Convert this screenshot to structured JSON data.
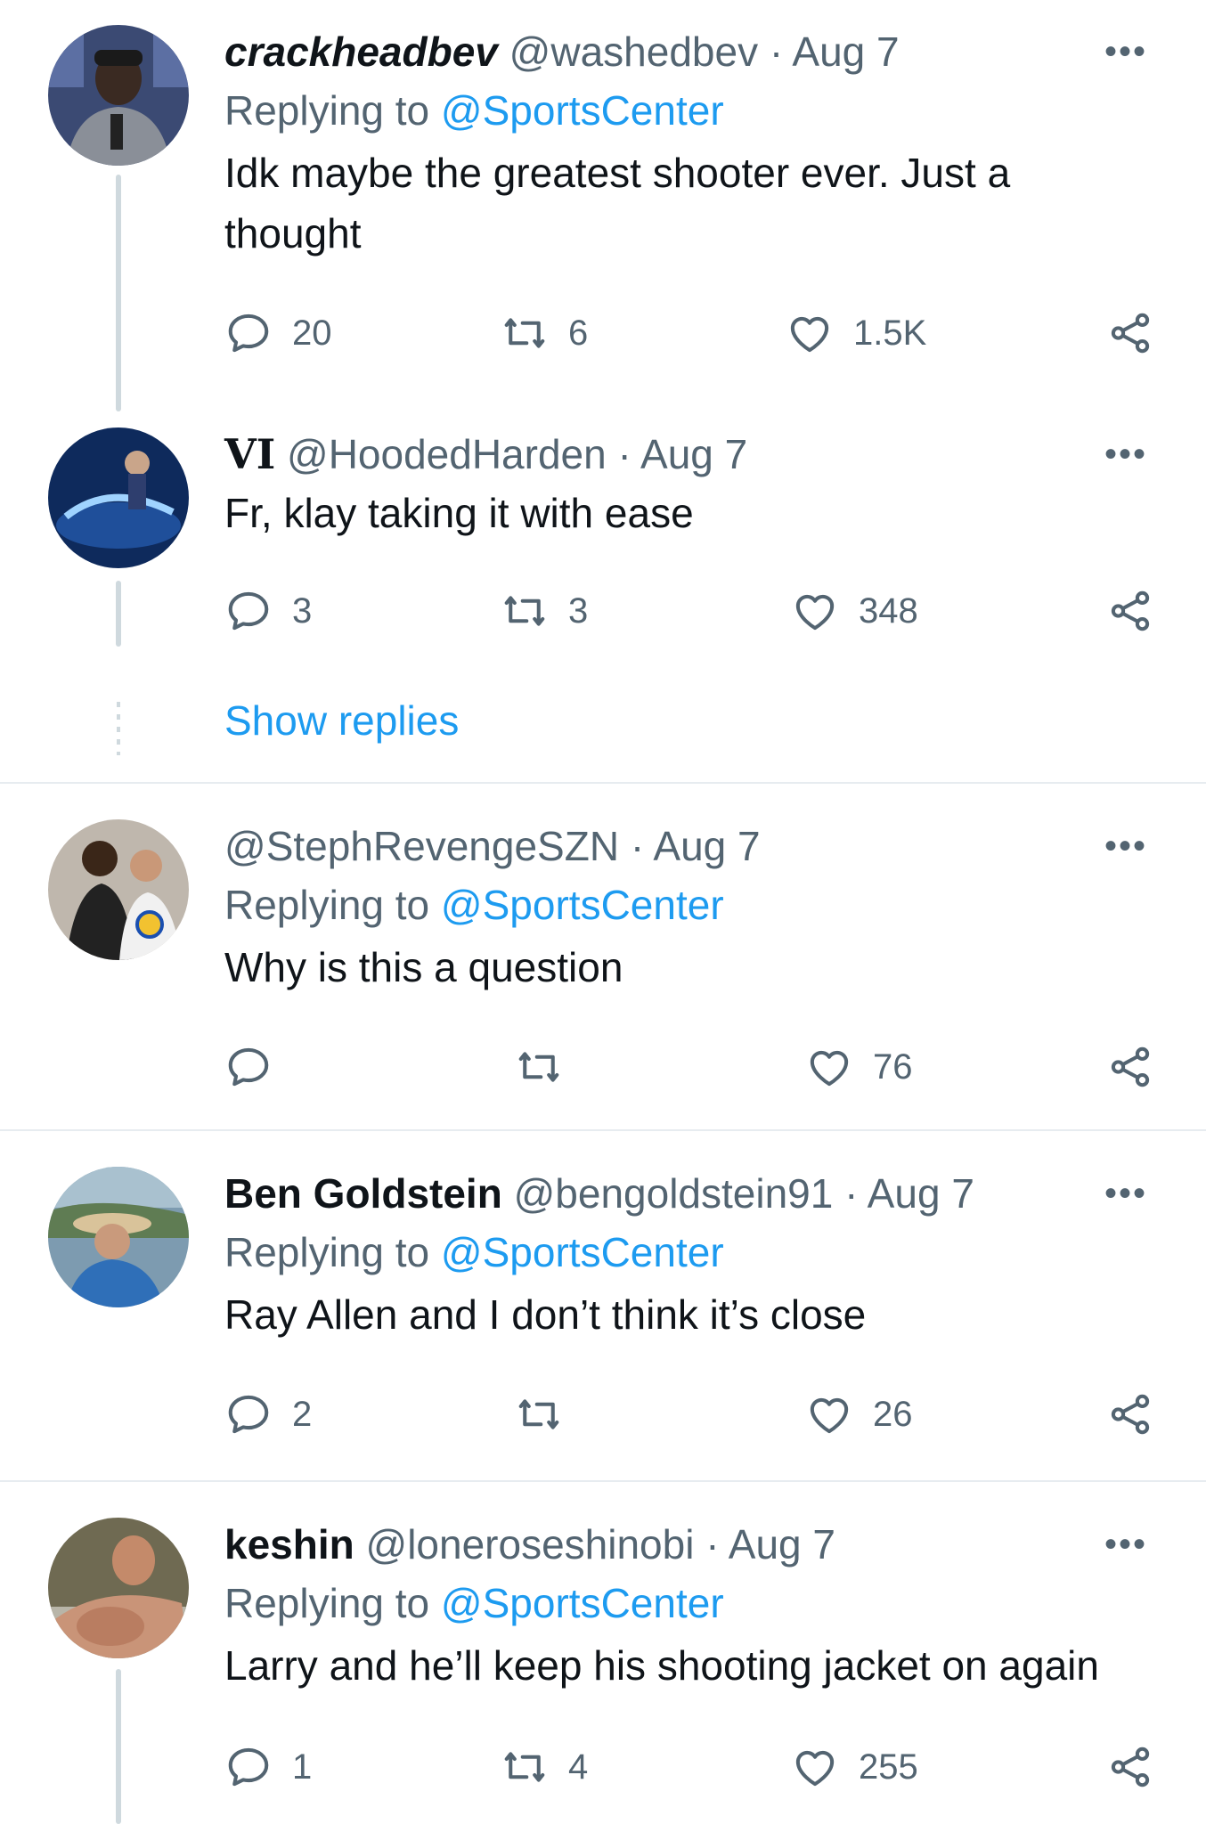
{
  "tweets": [
    {
      "display_name": "crackheadbev",
      "handle": "@washedbev",
      "date": "· Aug 7",
      "replying_prefix": "Replying to",
      "replying_to": "@SportsCenter",
      "text": "Idk maybe the greatest shooter ever. Just a thought",
      "replies": "20",
      "retweets": "6",
      "likes": "1.5K"
    },
    {
      "display_name": "VI",
      "handle": "@HoodedHarden",
      "date": "· Aug 7",
      "text": "Fr, klay taking it with ease",
      "replies": "3",
      "retweets": "3",
      "likes": "348",
      "show_replies": "Show replies"
    },
    {
      "display_name": "",
      "handle": "@StephRevengeSZN",
      "date": "· Aug 7",
      "replying_prefix": "Replying to",
      "replying_to": "@SportsCenter",
      "text": "Why is this a question",
      "replies": "",
      "retweets": "",
      "likes": "76"
    },
    {
      "display_name": "Ben Goldstein",
      "handle": "@bengoldstein91",
      "date": "· Aug 7",
      "replying_prefix": "Replying to",
      "replying_to": "@SportsCenter",
      "text": "Ray Allen and I don’t think it’s close",
      "replies": "2",
      "retweets": "",
      "likes": "26"
    },
    {
      "display_name": "keshin",
      "handle": "@loneroseshinobi",
      "date": "· Aug 7",
      "replying_prefix": "Replying to",
      "replying_to": "@SportsCenter",
      "text": "Larry and he’ll keep his shooting jacket on again",
      "replies": "1",
      "retweets": "4",
      "likes": "255"
    }
  ],
  "icons": {
    "reply": "reply-icon",
    "retweet": "retweet-icon",
    "like": "heart-icon",
    "share": "share-icon",
    "more": "more-icon"
  },
  "colors": {
    "link": "#1d9bf0",
    "secondary_text": "#536471",
    "thread_line": "#cfd9de",
    "divider": "#e7ecf0"
  }
}
